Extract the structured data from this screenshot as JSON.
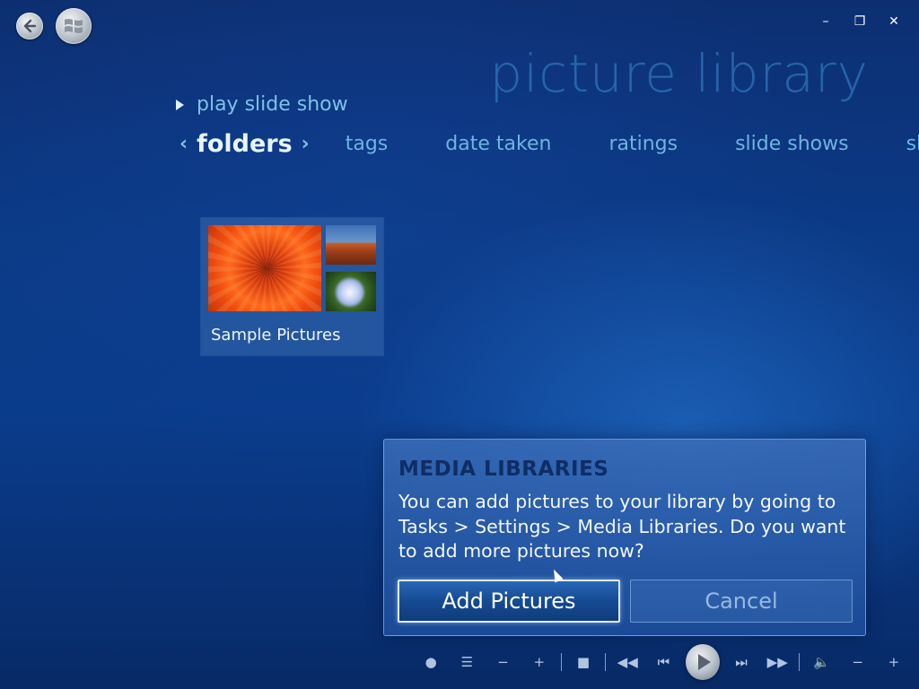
{
  "header": {
    "title": "picture library",
    "window_controls": {
      "minimize": "–",
      "restore": "❐",
      "close": "✕"
    }
  },
  "actions": {
    "play_slide_show": "play slide show"
  },
  "pivot": {
    "active": "folders",
    "tabs": [
      "tags",
      "date taken",
      "ratings",
      "slide shows",
      "sh"
    ]
  },
  "folders": [
    {
      "label": "Sample Pictures"
    }
  ],
  "dialog": {
    "title": "MEDIA LIBRARIES",
    "body": "You can add pictures to your library by going to Tasks > Settings > Media Libraries. Do you want to add more pictures now?",
    "add_label": "Add Pictures",
    "cancel_label": "Cancel"
  },
  "transport": {
    "record": "●",
    "guide": "☰",
    "channel_down": "−",
    "channel_up": "+",
    "stop": "■",
    "rewind": "◀◀",
    "previous": "⏮",
    "next": "⏭",
    "fast_forward": "▶▶",
    "volume": "🔈",
    "volume_down": "−",
    "volume_up": "+"
  }
}
